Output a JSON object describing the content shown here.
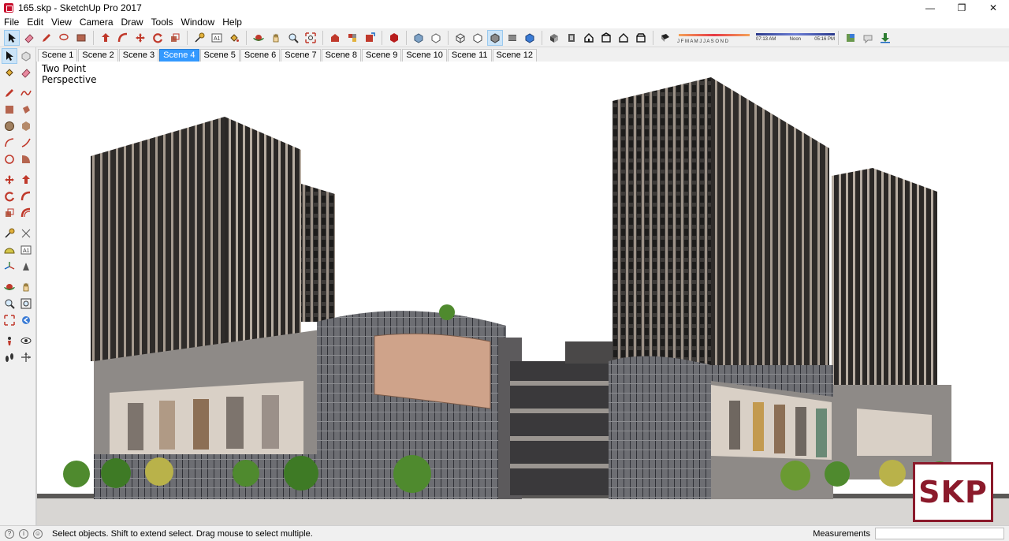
{
  "window": {
    "title": "165.skp - SketchUp Pro 2017",
    "controls": {
      "minimize": "—",
      "maximize": "❐",
      "close": "✕"
    }
  },
  "menu": [
    "File",
    "Edit",
    "View",
    "Camera",
    "Draw",
    "Tools",
    "Window",
    "Help"
  ],
  "toolbar": {
    "shadow_months": "J F M A M J J A S O N D",
    "time_start": "07:13 AM",
    "time_noon": "Noon",
    "time_end": "05:16 PM",
    "icons": [
      "select-icon",
      "eraser-icon",
      "pencil-icon",
      "lasso-icon",
      "paint-bucket-icon",
      "push-pull-icon",
      "offset-icon",
      "move-icon",
      "rotate-icon",
      "scale-icon",
      "tape-measure-icon",
      "text-icon",
      "paint-icon",
      "orbit-icon",
      "pan-icon",
      "zoom-icon",
      "zoom-extents-icon",
      "component-icon",
      "group-icon",
      "section-icon",
      "warehouse-icon",
      "xray-icon",
      "wireframe-icon",
      "hidden-line-icon",
      "shaded-icon",
      "textured-icon",
      "monochrome-icon",
      "iso-view-icon",
      "top-view-icon",
      "front-view-icon",
      "right-view-icon",
      "back-view-icon",
      "left-view-icon",
      "shadow-toggle-icon",
      "geolocation-icon",
      "extension-icon",
      "download-icon"
    ]
  },
  "scenes": [
    {
      "label": "Scene 1",
      "active": false
    },
    {
      "label": "Scene 2",
      "active": false
    },
    {
      "label": "Scene 3",
      "active": false
    },
    {
      "label": "Scene 4",
      "active": true
    },
    {
      "label": "Scene 5",
      "active": false
    },
    {
      "label": "Scene 6",
      "active": false
    },
    {
      "label": "Scene 7",
      "active": false
    },
    {
      "label": "Scene 8",
      "active": false
    },
    {
      "label": "Scene 9",
      "active": false
    },
    {
      "label": "Scene 10",
      "active": false
    },
    {
      "label": "Scene 11",
      "active": false
    },
    {
      "label": "Scene 12",
      "active": false
    }
  ],
  "viewport": {
    "camera_label": "Two Point\nPerspective",
    "logo_text": "SKP"
  },
  "status": {
    "message": "Select objects. Shift to extend select. Drag mouse to select multiple.",
    "measurements_label": "Measurements",
    "measurements_value": ""
  },
  "colors": {
    "accent": "#3399ff",
    "logo": "#8b1a2b",
    "tower_dark": "#2f2c2a",
    "tower_frame": "#a69b90",
    "podium": "#8e8a87"
  }
}
